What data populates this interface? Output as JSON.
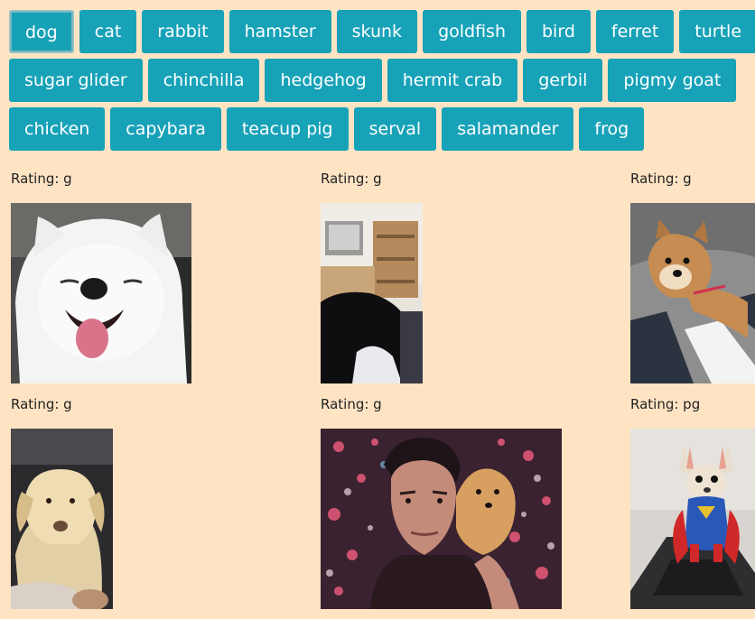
{
  "buttons": [
    [
      "dog",
      "cat",
      "rabbit",
      "hamster",
      "skunk",
      "goldfish",
      "bird",
      "ferret",
      "turtle"
    ],
    [
      "sugar glider",
      "chinchilla",
      "hedgehog",
      "hermit crab",
      "gerbil",
      "pigmy goat"
    ],
    [
      "chicken",
      "capybara",
      "teacup pig",
      "serval",
      "salamander",
      "frog"
    ]
  ],
  "active_button": "dog",
  "gifs": [
    {
      "rating_label": "Rating: g",
      "image": "white-samoyed-dog-smiling"
    },
    {
      "rating_label": "Rating: g",
      "image": "black-cat-in-room"
    },
    {
      "rating_label": "Rating: g",
      "image": "shiba-inu-dog-on-bed"
    },
    {
      "rating_label": "Rating: g",
      "image": "yellow-labrador-dog"
    },
    {
      "rating_label": "Rating: g",
      "image": "man-holding-pomeranian"
    },
    {
      "rating_label": "Rating: pg",
      "image": "chihuahua-superman-costume"
    }
  ]
}
